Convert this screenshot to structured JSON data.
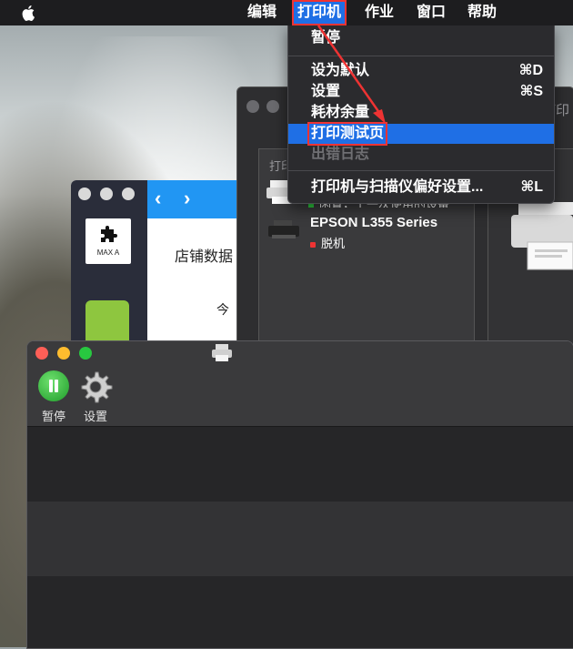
{
  "menubar": {
    "items": [
      "编辑",
      "打印机",
      "作业",
      "窗口",
      "帮助"
    ],
    "active_index": 1
  },
  "printer_menu": {
    "items": [
      {
        "label": "暂停",
        "shortcut": "",
        "disabled": false
      },
      {
        "label": "设为默认",
        "shortcut": "⌘D",
        "disabled": false
      },
      {
        "label": "设置",
        "shortcut": "⌘S",
        "disabled": false
      },
      {
        "label": "耗材余量",
        "shortcut": "",
        "disabled": false
      },
      {
        "label": "打印测试页",
        "shortcut": "",
        "disabled": false,
        "highlighted": true
      },
      {
        "label": "出错日志",
        "shortcut": "",
        "disabled": true
      },
      {
        "label": "打印机与扫描仪偏好设置...",
        "shortcut": "⌘L",
        "disabled": false
      }
    ]
  },
  "prefs_window": {
    "title_partial": "打印",
    "list_header": "打印",
    "printers": [
      {
        "name": "",
        "status": "闲置，上一次使用的设备"
      },
      {
        "name": "EPSON L355 Series",
        "status": "脱机"
      }
    ]
  },
  "app_window": {
    "tile_label": "MAX A",
    "heading": "店铺数据",
    "subtext": "今"
  },
  "queue_window": {
    "toolbar": {
      "pause_label": "暂停",
      "settings_label": "设置"
    }
  },
  "colors": {
    "accent": "#1f6fe5",
    "highlight_outline": "#e33333",
    "offline_dot": "#e33333"
  }
}
